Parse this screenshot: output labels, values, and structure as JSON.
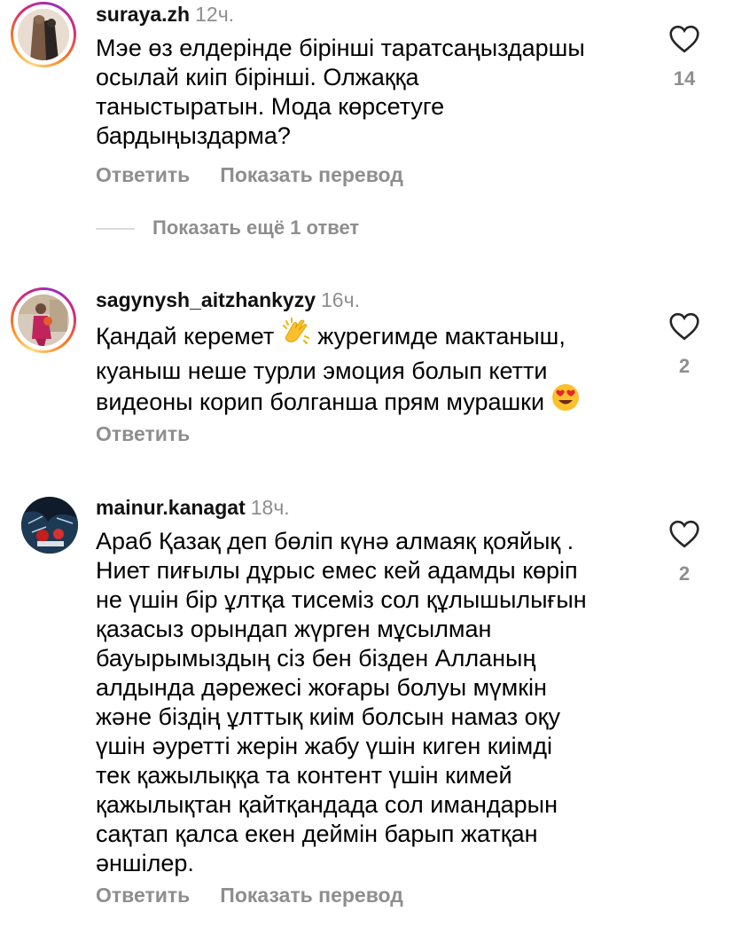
{
  "comments": [
    {
      "username": "suraya.zh",
      "time": "12ч.",
      "lines": [
        "Мэе өз елдерінде бірінші таратсаңыздаршы",
        "осылай киіп бірінші. Олжаққа",
        "таныстыратын. Мода көрсетуге",
        "бардыңыздарма?"
      ],
      "likes": "14",
      "reply_label": "Ответить",
      "translate_label": "Показать перевод",
      "more_replies_label": "Показать ещё 1 ответ"
    },
    {
      "username": "sagynysh_aitzhankyzy",
      "time": "16ч.",
      "line1_before_emoji": "Қандай керемет ",
      "line1_after_emoji": " журегимде мактаныш,",
      "line2": "куаныш неше турли эмоция болып кетти",
      "line3": "видеоны корип болганша прям мурашки ",
      "emoji_1": "clapping-hands-icon",
      "emoji_2": "heart-eyes-face-icon",
      "likes": "2",
      "reply_label": "Ответить"
    },
    {
      "username": "mainur.kanagat",
      "time": "18ч.",
      "lines": [
        "Араб Қазақ деп бөліп күнә алмаяқ қояйық .",
        "Ниет пиғылы дұрыс емес кей адамды көріп",
        "не үшін бір ұлтқа тисеміз сол құлышылығын",
        "қазасыз орындап жүрген мұсылман",
        "бауырымыздың сіз бен бізден  Алланың",
        "алдында дәрежесі жоғары болуы мүмкін",
        "және біздің ұлттық киім болсын намаз оқу",
        "үшін әуретті жерін жабу үшін киген киімді",
        "тек қажылыққа та контент үшін кимей",
        "қажылықтан қайтқандада сол имандарын",
        "сақтап қалса екен деймін барып жатқан",
        "әншілер."
      ],
      "likes": "2",
      "reply_label": "Ответить",
      "translate_label": "Показать перевод"
    }
  ],
  "colors": {
    "secondary_text": "#8e8e8e",
    "primary_text": "#000000",
    "story_ring": [
      "#feda75",
      "#fa7e1e",
      "#d62976",
      "#962fbf"
    ]
  }
}
